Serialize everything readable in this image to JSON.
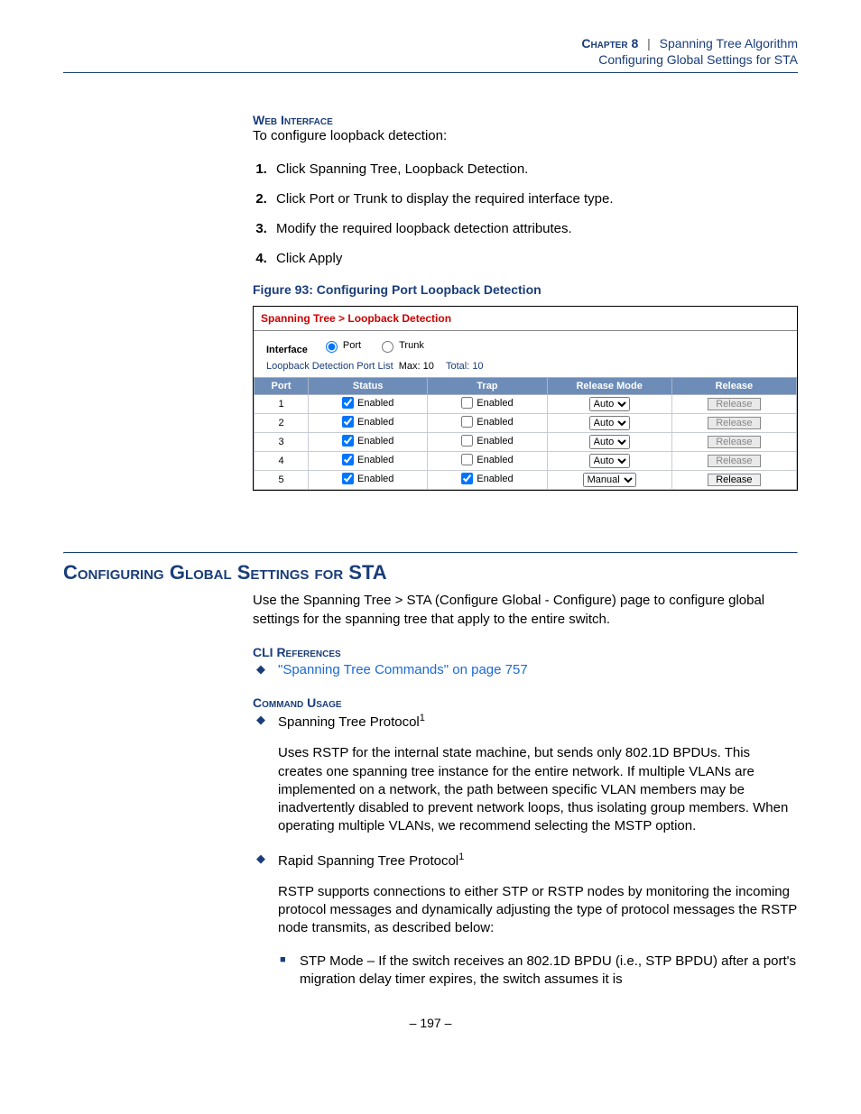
{
  "header": {
    "chapter_label": "Chapter 8",
    "separator": "|",
    "chapter_title": "Spanning Tree Algorithm",
    "subtitle": "Configuring Global Settings for STA"
  },
  "web_interface": {
    "heading": "Web Interface",
    "intro": "To configure loopback detection:",
    "steps": [
      "Click Spanning Tree, Loopback Detection.",
      "Click Port or Trunk to display the required interface type.",
      "Modify the required loopback detection attributes.",
      "Click Apply"
    ]
  },
  "figure": {
    "caption": "Figure 93:  Configuring Port Loopback Detection",
    "breadcrumb": "Spanning Tree > Loopback Detection",
    "interface_label": "Interface",
    "radio_port": "Port",
    "radio_trunk": "Trunk",
    "list_label": "Loopback Detection Port List",
    "max_label": "Max: 10",
    "total_label": "Total: 10",
    "cols": {
      "port": "Port",
      "status": "Status",
      "trap": "Trap",
      "mode": "Release Mode",
      "release": "Release"
    },
    "enabled_text": "Enabled",
    "release_btn": "Release",
    "rows": [
      {
        "port": "1",
        "status_checked": true,
        "trap_checked": false,
        "mode": "Auto",
        "release_enabled": false
      },
      {
        "port": "2",
        "status_checked": true,
        "trap_checked": false,
        "mode": "Auto",
        "release_enabled": false
      },
      {
        "port": "3",
        "status_checked": true,
        "trap_checked": false,
        "mode": "Auto",
        "release_enabled": false
      },
      {
        "port": "4",
        "status_checked": true,
        "trap_checked": false,
        "mode": "Auto",
        "release_enabled": false
      },
      {
        "port": "5",
        "status_checked": true,
        "trap_checked": true,
        "mode": "Manual",
        "release_enabled": true
      }
    ]
  },
  "section": {
    "heading": "Configuring Global Settings for STA",
    "intro": "Use the Spanning Tree > STA (Configure Global - Configure) page to configure global settings for the spanning tree that apply to the entire switch."
  },
  "cli": {
    "heading": "CLI References",
    "link": "\"Spanning Tree Commands\" on page 757"
  },
  "usage": {
    "heading": "Command Usage",
    "item1_title": "Spanning Tree Protocol",
    "item1_sup": "1",
    "item1_body": "Uses RSTP for the internal state machine, but sends only 802.1D BPDUs. This creates one spanning tree instance for the entire network. If multiple VLANs are implemented on a network, the path between specific VLAN members may be inadvertently disabled to prevent network loops, thus isolating group members. When operating multiple VLANs, we recommend selecting the MSTP option.",
    "item2_title": "Rapid Spanning Tree Protocol",
    "item2_sup": "1",
    "item2_body": "RSTP supports connections to either STP or RSTP nodes by monitoring the incoming protocol messages and dynamically adjusting the type of protocol messages the RSTP node transmits, as described below:",
    "sub1": "STP Mode – If the switch receives an 802.1D BPDU (i.e., STP BPDU) after a port's migration delay timer expires, the switch assumes it is"
  },
  "page_number": "–  197  –"
}
